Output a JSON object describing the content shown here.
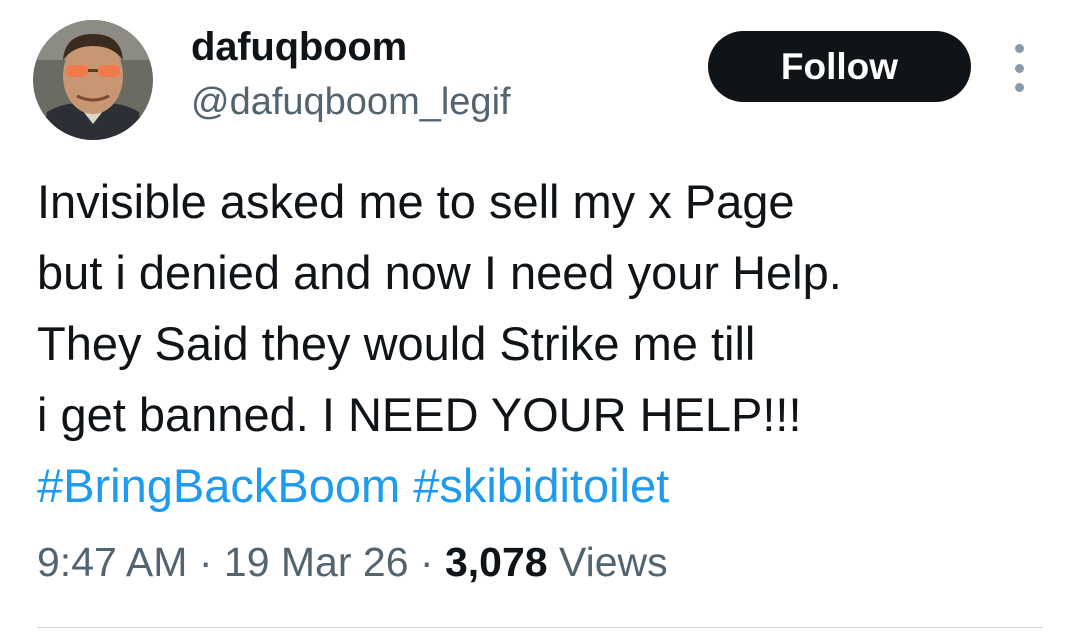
{
  "author": {
    "display_name": "dafuqboom",
    "handle": "@dafuqboom_legif",
    "avatar_icon": "profile-avatar-photo"
  },
  "actions": {
    "follow_label": "Follow",
    "more_icon": "vertical-ellipsis-icon"
  },
  "tweet": {
    "lines": [
      "Invisible asked me to sell my x Page",
      "but i denied and now I need your Help.",
      "They Said they would Strike me till",
      "i get banned. I NEED YOUR HELP!!!"
    ],
    "hashtags": [
      "#BringBackBoom",
      "#skibiditoilet"
    ]
  },
  "meta": {
    "time": "9:47 AM",
    "separator": "·",
    "date": "19 Mar 26",
    "views_count": "3,078",
    "views_label": "Views"
  },
  "colors": {
    "text": "#0f1419",
    "secondary": "#536471",
    "link": "#1d9bf0",
    "follow_bg": "#0f1419",
    "divider": "#cfd9de"
  }
}
